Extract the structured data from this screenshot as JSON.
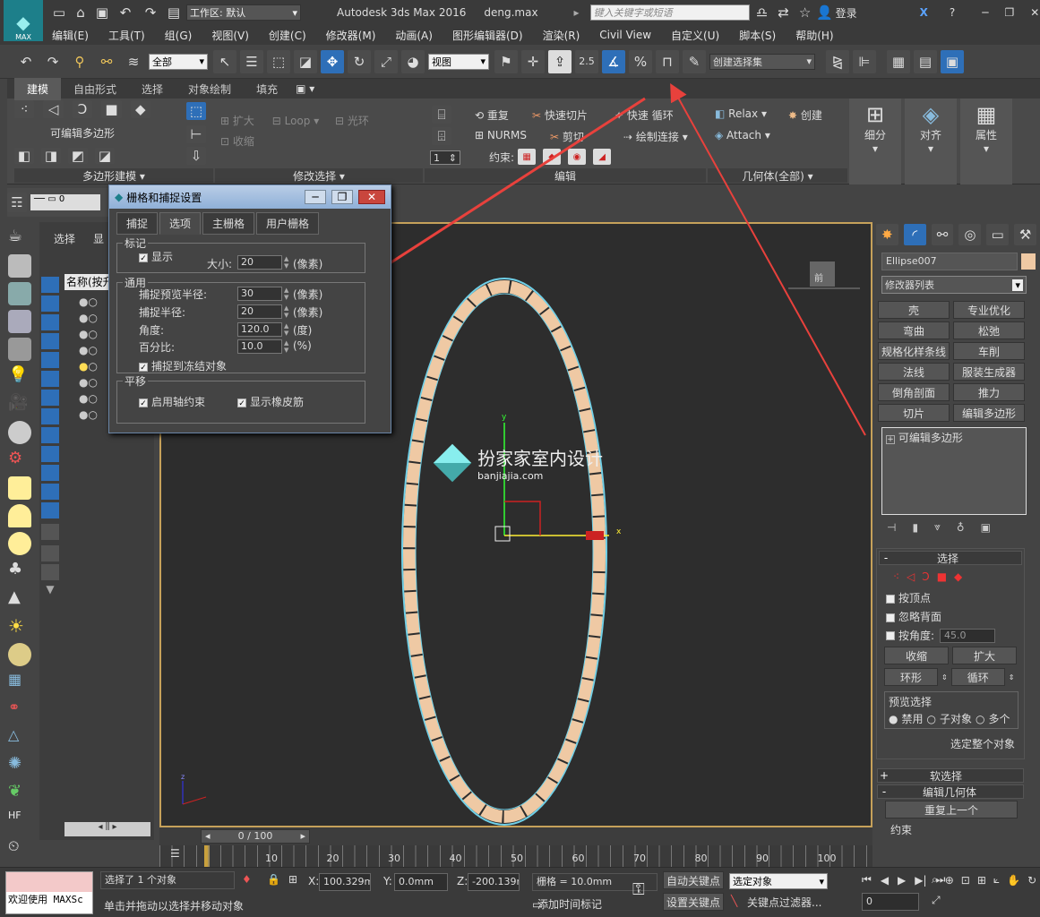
{
  "title": {
    "app": "Autodesk 3ds Max 2016",
    "file": "deng.max",
    "workspace_label": "工作区: 默认",
    "search_placeholder": "键入关键字或短语",
    "login": "登录",
    "logo": "MAX"
  },
  "menu": [
    "编辑(E)",
    "工具(T)",
    "组(G)",
    "视图(V)",
    "创建(C)",
    "修改器(M)",
    "动画(A)",
    "图形编辑器(D)",
    "渲染(R)",
    "Civil View",
    "自定义(U)",
    "脚本(S)",
    "帮助(H)"
  ],
  "toolbar": {
    "selection_filter": "全部",
    "ref_coord": "视图",
    "snap_25": "2.5",
    "selection_set": "创建选择集"
  },
  "ribbon": {
    "tabs": [
      "建模",
      "自由形式",
      "选择",
      "对象绘制",
      "填充"
    ],
    "poly_label": "可编辑多边形",
    "group_polymodel": "多边形建模 ▾",
    "group_modsel": "修改选择 ▾",
    "group_edit": "编辑",
    "group_geom": "几何体(全部) ▾",
    "grow": "扩大",
    "shrink": "收缩",
    "loop": "Loop",
    "ring": "光环",
    "repeat": "重复",
    "quickslice": "快速切片",
    "quickloop": "快速 循环",
    "nurms": "NURMS",
    "cut": "剪切",
    "paintconn": "绘制连接",
    "constraint": "约束:",
    "spin_value": "1",
    "relax": "Relax",
    "attach": "Attach",
    "create": "创建",
    "subdivide": "细分",
    "align": "对齐",
    "props": "属性"
  },
  "dialog": {
    "title": "栅格和捕捉设置",
    "tabs": [
      "捕捉",
      "选项",
      "主栅格",
      "用户栅格"
    ],
    "marker_group": "标记",
    "show": "显示",
    "size_label": "大小:",
    "size": "20",
    "pixel": "(像素)",
    "general_group": "通用",
    "preview_radius_label": "捕捉预览半径:",
    "preview_radius": "30",
    "snap_radius_label": "捕捉半径:",
    "snap_radius": "20",
    "angle_label": "角度:",
    "angle": "120.0",
    "degree": "(度)",
    "percent_label": "百分比:",
    "percent": "10.0",
    "percent_unit": "(%)",
    "snap_frozen": "捕捉到冻结对象",
    "translate_group": "平移",
    "axis_constraint": "启用轴约束",
    "rubber_band": "显示橡皮筋"
  },
  "scene": {
    "select_tab": "选择",
    "display_tab": "显",
    "name_header": "名称(按升"
  },
  "viewport": {
    "watermark_cn": "扮家家室内设计",
    "watermark_url": "banjiajia.com",
    "cube_label": "前"
  },
  "command_panel": {
    "object_name": "Ellipse007",
    "modifier_list": "修改器列表",
    "modifier_buttons": [
      "壳",
      "专业优化",
      "弯曲",
      "松弛",
      "规格化样条线",
      "车削",
      "法线",
      "服装生成器",
      "倒角剖面",
      "推力",
      "切片",
      "编辑多边形"
    ],
    "stack_item": "可编辑多边形",
    "rollout_select": "选择",
    "by_vertex": "按顶点",
    "ignore_back": "忽略背面",
    "by_angle": "按角度:",
    "angle_value": "45.0",
    "shrink": "收缩",
    "grow": "扩大",
    "ring": "环形",
    "loop": "循环",
    "preview_select": "预览选择",
    "disabled": "禁用",
    "subobject": "子对象",
    "multi": "多个",
    "select_whole": "选定整个对象",
    "soft_select": "软选择",
    "edit_geometry": "编辑几何体",
    "repeat_last": "重复上一个",
    "constraints": "约束"
  },
  "timeline": {
    "frame": "0 / 100",
    "ticks": [
      "10",
      "20",
      "30",
      "40",
      "50",
      "60",
      "70",
      "80",
      "90",
      "100"
    ]
  },
  "status": {
    "welcome": "欢迎使用 MAXSc",
    "selected": "选择了 1 个对象",
    "hint": "单击并拖动以选择并移动对象",
    "x_label": "X:",
    "x": "100.329mm",
    "y_label": "Y:",
    "y": "0.0mm",
    "z_label": "Z:",
    "z": "-200.139mm",
    "grid": "栅格 = 10.0mm",
    "add_tag": "添加时间标记",
    "auto_key": "自动关键点",
    "set_key": "设置关键点",
    "selected_obj": "选定对象",
    "key_filters": "关键点过滤器...",
    "frame_field": "0"
  },
  "colors": {
    "accent": "#2e6fb8",
    "viewport_border": "#c6a15a",
    "ring_fill": "#efc9a4",
    "ring_edge": "#6fd0e8",
    "arrow": "#e8413c"
  }
}
